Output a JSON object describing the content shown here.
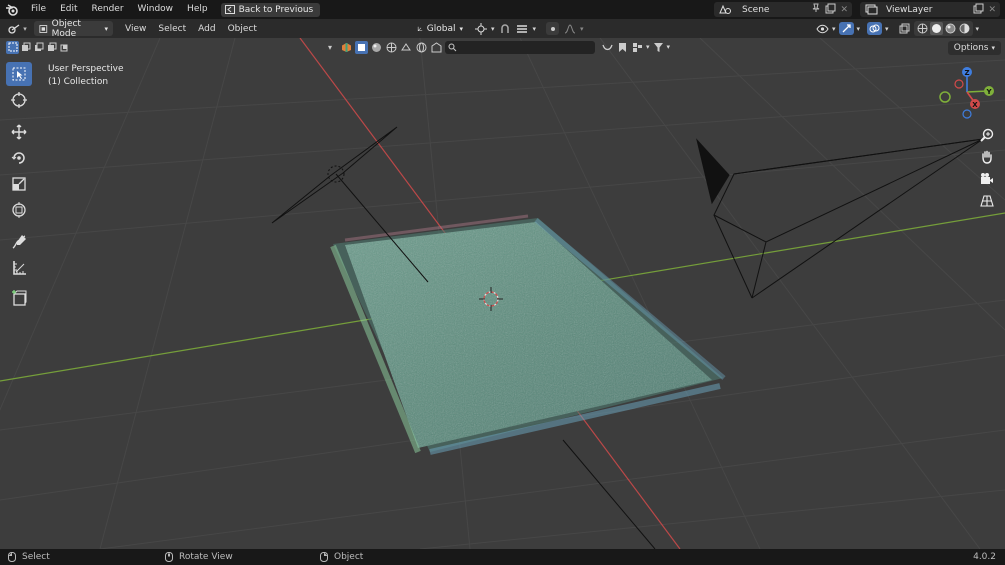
{
  "topbar": {
    "menus": [
      "File",
      "Edit",
      "Render",
      "Window",
      "Help"
    ],
    "back_button": "Back to Previous",
    "scene_name": "Scene",
    "viewlayer_name": "ViewLayer"
  },
  "header": {
    "mode": "Object Mode",
    "menus": [
      "View",
      "Select",
      "Add",
      "Object"
    ],
    "transform_orientation": "Global"
  },
  "viewport": {
    "perspective_label": "User Perspective",
    "collection_label": "(1) Collection",
    "options_label": "Options",
    "gizmo_axes": {
      "x": "X",
      "y": "Y",
      "z": "Z"
    },
    "colors": {
      "x_axis": "#d24a4a",
      "y_axis": "#7fb03a",
      "z_axis": "#3f7ee0",
      "background": "#3d3d3d",
      "grass": "#5c8a7a"
    }
  },
  "tools": [
    "select-box-icon",
    "cursor-icon",
    "move-icon",
    "rotate-icon",
    "scale-icon",
    "transform-icon",
    "annotate-icon",
    "measure-icon",
    "add-cube-icon"
  ],
  "statusbar": {
    "select": "Select",
    "rotate_view": "Rotate View",
    "object": "Object",
    "version": "4.0.2"
  }
}
